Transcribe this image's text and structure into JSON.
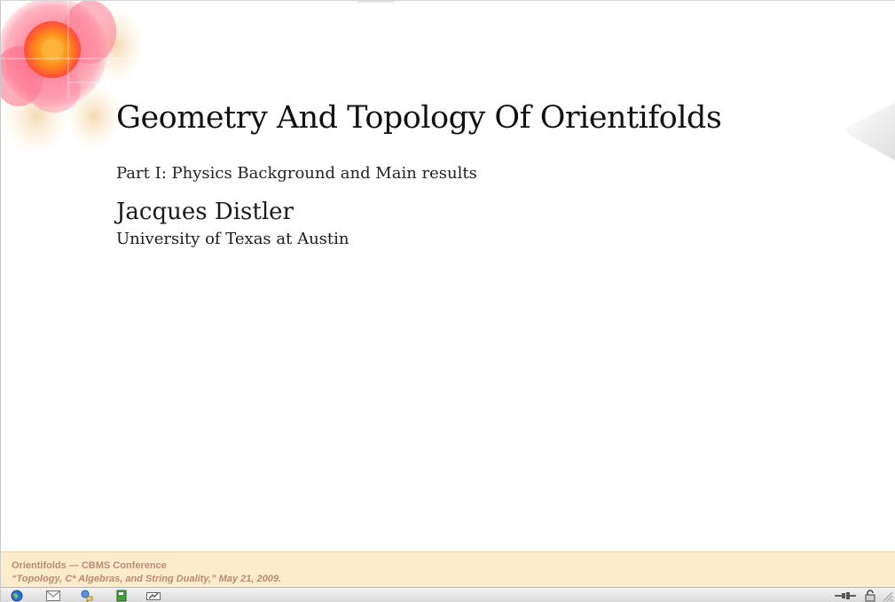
{
  "slide": {
    "title": "Geometry And Topology Of Orientifolds",
    "subtitle": "Part I: Physics Background and Main results",
    "author": "Jacques Distler",
    "affiliation": "University of Texas at Austin"
  },
  "footer": {
    "line1": "Orientifolds — CBMS Conference",
    "line2": "“Topology, C* Algebras, and String Duality,” May 21, 2009."
  },
  "statusbar": {
    "left_icons": [
      "globe-icon",
      "mail-icon",
      "chat-icon",
      "addressbook-icon",
      "composer-icon"
    ],
    "right_icons": [
      "online-connection-icon",
      "security-lock-icon"
    ]
  },
  "colors": {
    "footer_bg": "#fdeccb",
    "footer_text": "#b98a72",
    "title_text": "#111111"
  }
}
